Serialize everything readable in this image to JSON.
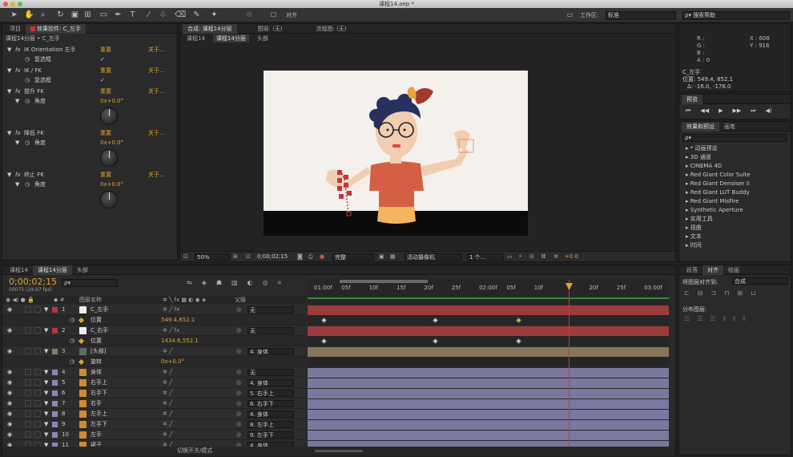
{
  "window": {
    "title": "课程14.aep *"
  },
  "toolbar": {
    "align_label": "对齐",
    "workspace_label": "工作区:",
    "workspace_value": "标准",
    "search_placeholder": "搜索帮助"
  },
  "effect_controls": {
    "tab_project": "项目",
    "tab_effects": "效果控件: C_左手",
    "breadcrumb": "课程14分层 • C_左手",
    "reset": "重置",
    "about": "关于...",
    "items": [
      {
        "name": "IK Orientation 左手",
        "sub": "复选框",
        "value": "✓"
      },
      {
        "name": "IK / FK",
        "sub": "复选框",
        "value": "✓"
      },
      {
        "name": "提升 FK",
        "sub": "角度",
        "value": "0x+0.0°"
      },
      {
        "name": "降低 FK",
        "sub": "角度",
        "value": "0x+0.0°"
      },
      {
        "name": "终止 FK",
        "sub": "角度",
        "value": "0x+0.0°"
      }
    ]
  },
  "composition": {
    "tab_comp": "合成: 课程14分层",
    "tab_layer": "图层: (无)",
    "tab_footage": "流程图: (无)",
    "nav": [
      "课程14",
      "课程14分层",
      "头部"
    ],
    "bottom": {
      "zoom": "50%",
      "timecode": "0;00;02;15",
      "quality": "完整",
      "camera": "活动摄像机",
      "views": "1 个...",
      "exposure": "+0.0"
    }
  },
  "info": {
    "r": "R :",
    "g": "G :",
    "b": "B :",
    "a": "A : 0",
    "x": "X : 608",
    "y": "Y : 916",
    "layer": "C_左手",
    "position": "位置: 549.4, 852.1",
    "delta": "Δ: -16.0, -176.0"
  },
  "preview": {
    "tab": "预览"
  },
  "effects_presets": {
    "tab": "效果和预设",
    "tab2": "画笔",
    "search": "ρ▾",
    "items": [
      "* 动画预设",
      "3D 通道",
      "CINEMA 4D",
      "Red Giant Color Suite",
      "Red Giant Denoiser II",
      "Red Giant LUT Buddy",
      "Red Giant MisFire",
      "Synthetic Aperture",
      "实用工具",
      "扭曲",
      "文本",
      "时间"
    ]
  },
  "align": {
    "tab_para": "段落",
    "tab_align": "对齐",
    "tab_draw": "绘画",
    "align_to": "将图层对齐到:",
    "align_target": "合成",
    "distribute": "分布图层:"
  },
  "timeline": {
    "tabs": [
      "课程14",
      "课程14分层",
      "头部"
    ],
    "timecode": "0;00;02;15",
    "fps": "00075 (29.97 fps)",
    "search": "ρ▾",
    "col_name": "图层名称",
    "col_parent": "父级",
    "ruler": [
      "01:00f",
      "05f",
      "10f",
      "15f",
      "20f",
      "25f",
      "02:00f",
      "05f",
      "10f",
      "",
      "20f",
      "25f",
      "03:00f"
    ],
    "footer": "切换开关/模式",
    "layers": [
      {
        "num": "1",
        "name": "C_左手",
        "parent": "无",
        "color": "#b23a3a",
        "type": "solid"
      },
      {
        "prop": "位置",
        "value": "549.4,852.1"
      },
      {
        "num": "2",
        "name": "C_右手",
        "parent": "无",
        "color": "#b23a3a",
        "type": "solid"
      },
      {
        "prop": "位置",
        "value": "1434.6,552.1"
      },
      {
        "num": "3",
        "name": "[头部]",
        "parent": "4. 身体",
        "color": "#8a7b60",
        "type": "comp"
      },
      {
        "prop": "旋转",
        "value": "0x+0.0°"
      },
      {
        "num": "4",
        "name": "身体",
        "parent": "无",
        "color": "#8a88b8",
        "type": "shape"
      },
      {
        "num": "5",
        "name": "右手上",
        "parent": "4. 身体",
        "color": "#8a88b8",
        "type": "shape"
      },
      {
        "num": "6",
        "name": "右手下",
        "parent": "5. 右手上",
        "color": "#8a88b8",
        "type": "shape"
      },
      {
        "num": "7",
        "name": "右手",
        "parent": "6. 右手下",
        "color": "#8a88b8",
        "type": "shape"
      },
      {
        "num": "8",
        "name": "左手上",
        "parent": "4. 身体",
        "color": "#8a88b8",
        "type": "shape"
      },
      {
        "num": "9",
        "name": "左手下",
        "parent": "8. 左手上",
        "color": "#8a88b8",
        "type": "shape"
      },
      {
        "num": "10",
        "name": "左手",
        "parent": "9. 左手下",
        "color": "#8a88b8",
        "type": "shape"
      },
      {
        "num": "11",
        "name": "裙子",
        "parent": "4. 身体",
        "color": "#8a88b8",
        "type": "shape"
      }
    ]
  }
}
